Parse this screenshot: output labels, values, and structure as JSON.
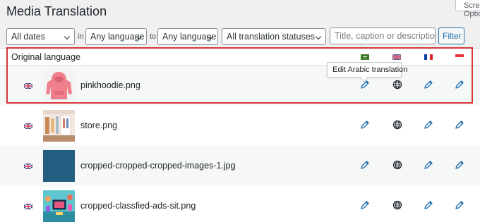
{
  "page": {
    "title": "Media Translation",
    "screen_options": "Screen Options"
  },
  "filters": {
    "dates": "All dates",
    "in_label": "in",
    "source_language": "Any language",
    "to_label": "to",
    "target_language": "Any language",
    "statuses": "All translation statuses",
    "search_placeholder": "Title, caption or description",
    "filter_button": "Filter"
  },
  "table": {
    "header": {
      "original_language": "Original language",
      "languages": [
        "Arabic",
        "English",
        "French",
        "Indonesian"
      ]
    },
    "rows": [
      {
        "filename": "pinkhoodie.png",
        "language": "English"
      },
      {
        "filename": "store.png",
        "language": "English"
      },
      {
        "filename": "cropped-cropped-cropped-images-1.jpg",
        "language": "English"
      },
      {
        "filename": "cropped-classfied-ads-sit.png",
        "language": "English"
      }
    ]
  },
  "tooltip": {
    "text": "Edit Arabic translation"
  },
  "colors": {
    "accent": "#2271b1",
    "highlight": "#d63638"
  },
  "icons": {
    "edit": "pencil-icon",
    "original": "globe-icon"
  }
}
